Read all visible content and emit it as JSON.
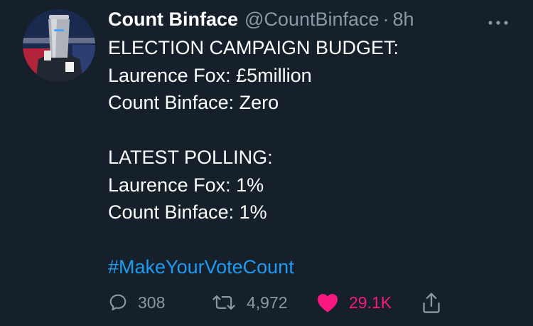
{
  "tweet": {
    "display_name": "Count Binface",
    "handle": "@CountBinface",
    "separator": "·",
    "time": "8h",
    "lines": [
      "ELECTION CAMPAIGN BUDGET:",
      "Laurence Fox: £5million",
      "Count Binface: Zero",
      "",
      "LATEST POLLING:",
      "Laurence Fox: 1%",
      "Count Binface: 1%",
      ""
    ],
    "hashtag": "#MakeYourVoteCount"
  },
  "actions": {
    "replies": "308",
    "retweets": "4,972",
    "likes": "29.1K"
  },
  "icons": {
    "more": "more-horizontal-icon",
    "reply": "reply-icon",
    "retweet": "retweet-icon",
    "like": "heart-icon",
    "share": "share-icon"
  },
  "colors": {
    "background": "#15202b",
    "text": "#ffffff",
    "secondary": "#8b98a5",
    "hashtag": "#1d9bf0",
    "like": "#f91880"
  }
}
